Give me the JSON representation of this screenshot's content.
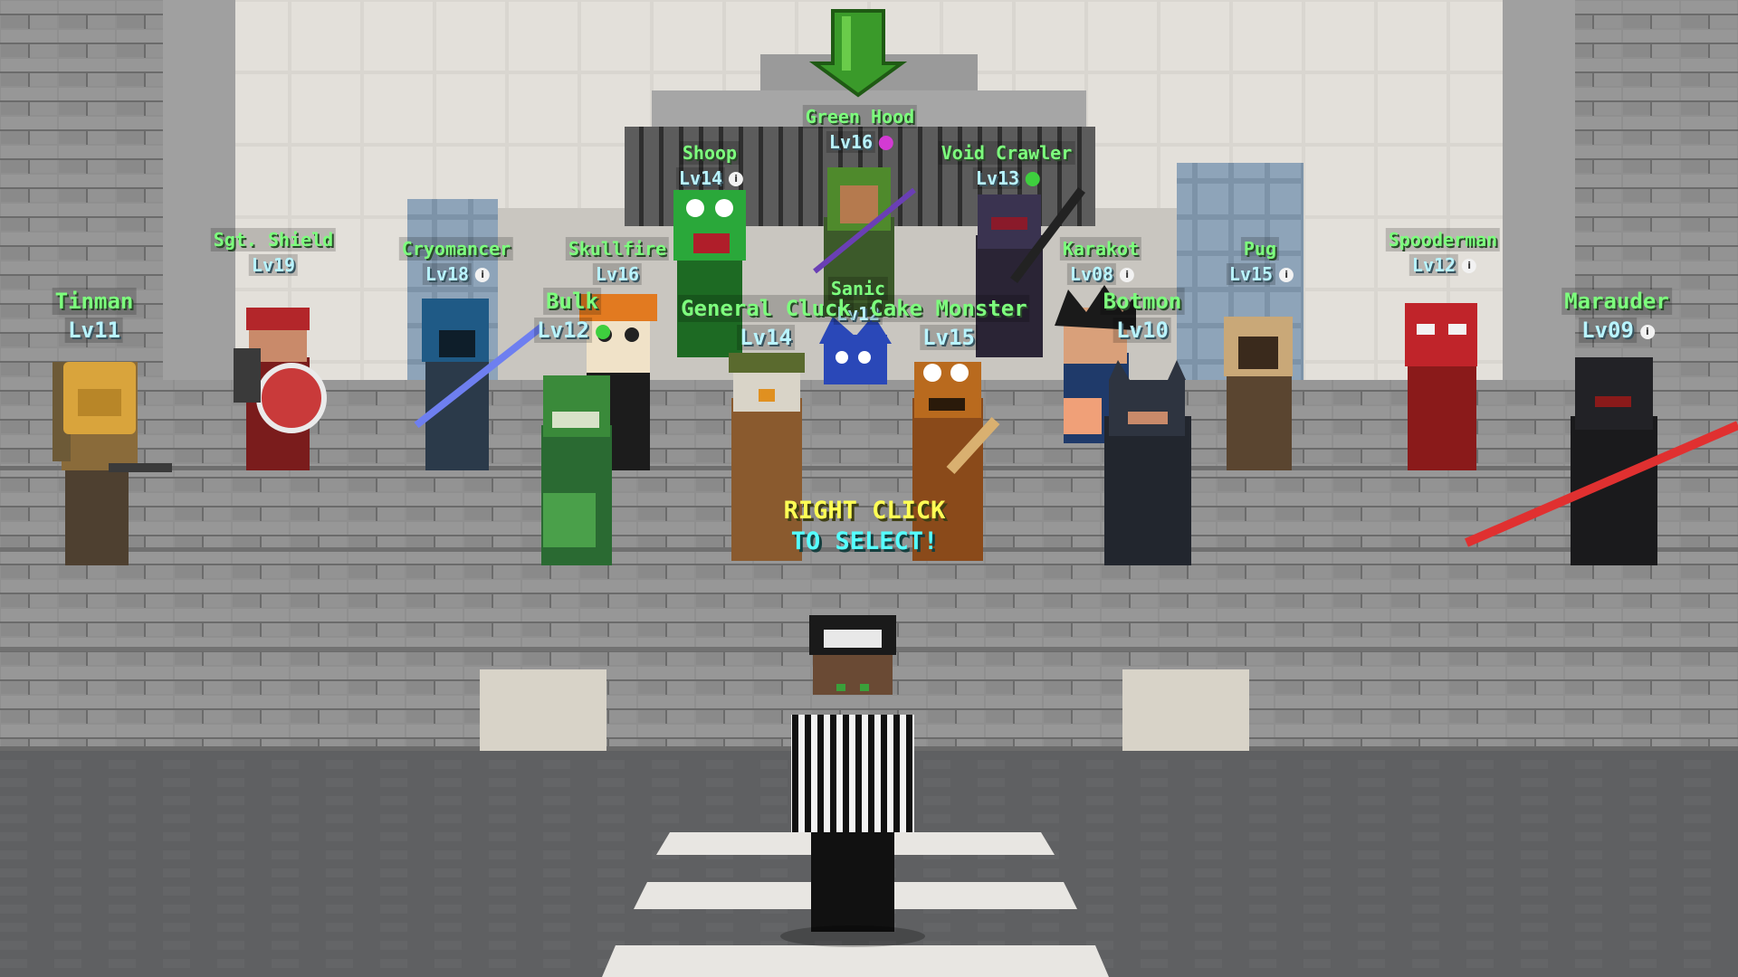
{
  "colors": {
    "name_text": "#7dff7d",
    "level_text": "#b9f4ff",
    "prompt_line1": "#ffff55",
    "prompt_line2": "#55ffff",
    "badge_white": "#f2f2f2",
    "badge_green": "#3ecf3e",
    "badge_magenta": "#d33ad3",
    "selector_arrow": "#3a9a2a"
  },
  "prompt": {
    "line1": "RIGHT CLICK",
    "line2": "TO SELECT!"
  },
  "selector_icon": "green-down-arrow-icon",
  "characters": [
    {
      "id": "green-hood",
      "name": "Green Hood",
      "level": "Lv16",
      "badge": "magenta"
    },
    {
      "id": "shoop",
      "name": "Shoop",
      "level": "Lv14",
      "badge": "white"
    },
    {
      "id": "void-crawler",
      "name": "Void Crawler",
      "level": "Lv13",
      "badge": "green"
    },
    {
      "id": "sgt-shield",
      "name": "Sgt. Shield",
      "level": "Lv19",
      "badge": "none"
    },
    {
      "id": "cryomancer",
      "name": "Cryomancer",
      "level": "Lv18",
      "badge": "white"
    },
    {
      "id": "skullfire",
      "name": "Skullfire",
      "level": "Lv16",
      "badge": "none"
    },
    {
      "id": "karakot",
      "name": "Karakot",
      "level": "Lv08",
      "badge": "white"
    },
    {
      "id": "pug",
      "name": "Pug",
      "level": "Lv15",
      "badge": "white"
    },
    {
      "id": "spooderman",
      "name": "Spooderman",
      "level": "Lv12",
      "badge": "white"
    },
    {
      "id": "sanic",
      "name": "Sanic",
      "level": "Lv12",
      "badge": "none"
    },
    {
      "id": "tinman",
      "name": "Tinman",
      "level": "Lv11",
      "badge": "none"
    },
    {
      "id": "bulk",
      "name": "Bulk",
      "level": "Lv12",
      "badge": "green"
    },
    {
      "id": "general-cluck",
      "name": "General Cluck",
      "level": "Lv14",
      "badge": "none"
    },
    {
      "id": "cake-monster",
      "name": "Cake Monster",
      "level": "Lv15",
      "badge": "none"
    },
    {
      "id": "botmon",
      "name": "Botmon",
      "level": "Lv10",
      "badge": "none"
    },
    {
      "id": "marauder",
      "name": "Marauder",
      "level": "Lv09",
      "badge": "white"
    }
  ]
}
